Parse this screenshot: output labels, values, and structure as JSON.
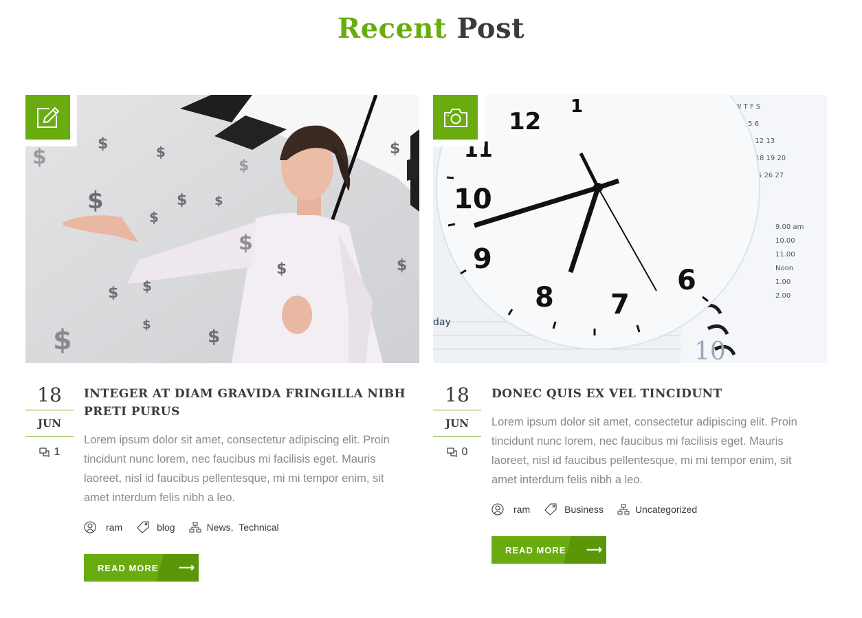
{
  "section": {
    "title_accent": "Recent",
    "title_rest": "Post"
  },
  "posts": [
    {
      "format_icon": "pencil-edit-icon",
      "day": "18",
      "month": "JUN",
      "comments": "1",
      "title": "INTEGER AT DIAM GRAVIDA FRINGILLA NIBH PRETI PURUS",
      "excerpt": "Lorem ipsum dolor sit amet, consectetur adipiscing elit. Proin tincidunt nunc lorem, nec faucibus mi facilisis eget. Mauris laoreet, nisl id faucibus pellentesque, mi mi tempor enim, sit amet interdum felis nibh a leo.",
      "author": "ram",
      "tag": "blog",
      "categories": [
        "News",
        "Technical"
      ],
      "read_more": "READ MORE"
    },
    {
      "format_icon": "camera-icon",
      "day": "18",
      "month": "JUN",
      "comments": "0",
      "title": "DONEC QUIS EX VEL TINCIDUNT",
      "excerpt": "Lorem ipsum dolor sit amet, consectetur adipiscing elit. Proin tincidunt nunc lorem, nec faucibus mi facilisis eget. Mauris laoreet, nisl id faucibus pellentesque, mi mi tempor enim, sit amet interdum felis nibh a leo.",
      "author": "ram",
      "tag": "Business",
      "categories": [
        "Uncategorized"
      ],
      "read_more": "READ MORE"
    }
  ],
  "colors": {
    "accent": "#6aac0f",
    "accent_dark": "#5a9608",
    "heading": "#3d3a38",
    "text": "#8a8a8a"
  }
}
